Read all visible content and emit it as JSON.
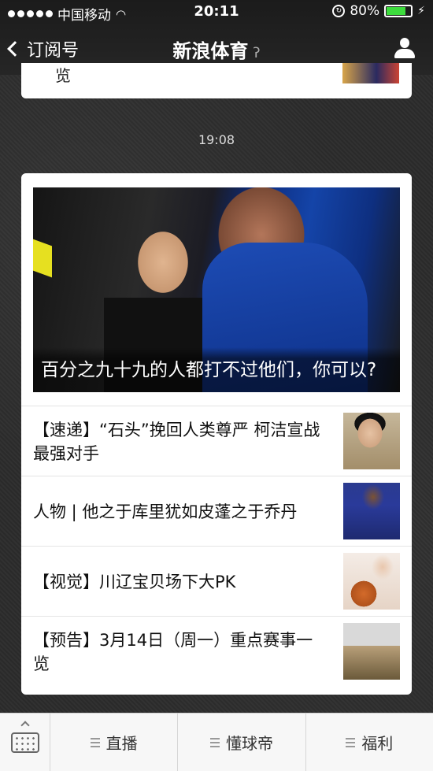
{
  "status": {
    "carrier": "中国移动",
    "time": "20:11",
    "battery": "80%",
    "battery_level": 0.8
  },
  "nav": {
    "back_label": "订阅号",
    "title": "新浪体育"
  },
  "prev_card": {
    "text_tail": "览"
  },
  "timestamp": "19:08",
  "card": {
    "hero_caption": "百分之九十九的人都打不过他们，你可以?",
    "items": [
      {
        "title": "【速递】“石头”挽回人类尊严 柯洁宣战最强对手"
      },
      {
        "title": "人物 | 他之于库里犹如皮蓬之于乔丹"
      },
      {
        "title": "【视觉】川辽宝贝场下大PK"
      },
      {
        "title": "【预告】3月14日（周一）重点赛事一览"
      }
    ]
  },
  "toolbar": {
    "tabs": [
      {
        "label": "直播"
      },
      {
        "label": "懂球帝"
      },
      {
        "label": "福利"
      }
    ]
  }
}
